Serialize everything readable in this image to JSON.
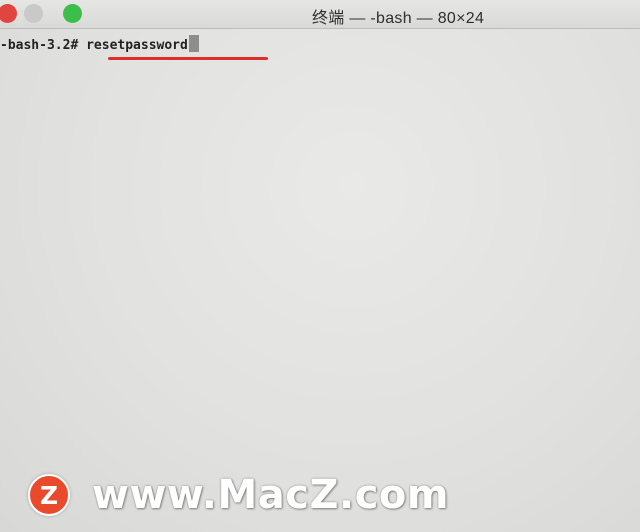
{
  "window": {
    "title": "终端 — -bash — 80×24"
  },
  "terminal": {
    "prompt": "-bash-3.2# ",
    "command": "resetpassword"
  },
  "annotation": {
    "underline_color": "#e12d2a"
  },
  "watermark": {
    "logo_letter": "Z",
    "text": "www.MacZ.com"
  },
  "colors": {
    "close": "#e0463f",
    "zoom": "#3cbf4a",
    "logo": "#ea4a2c"
  }
}
